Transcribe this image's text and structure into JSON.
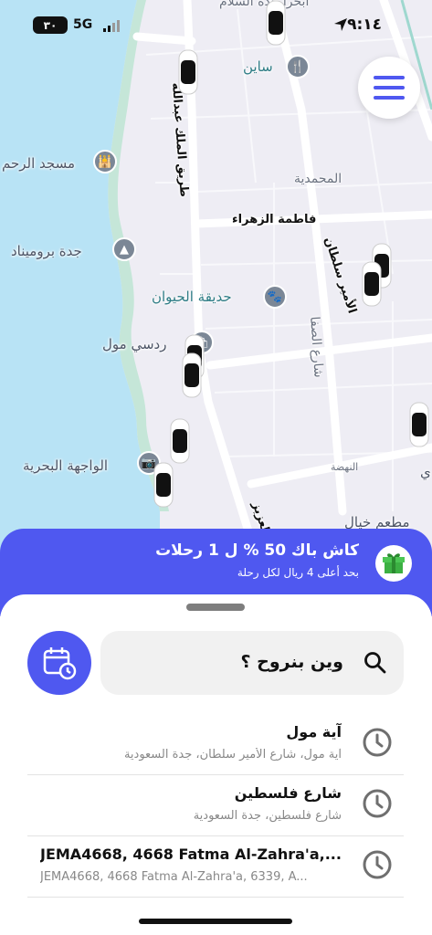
{
  "status_bar": {
    "time": "٩:١٤",
    "battery": "٣٠",
    "network": "5G"
  },
  "map": {
    "labels": {
      "sain": "ساين",
      "mosque": "مسجد الرحم",
      "mohammadia": "المحمدية",
      "fatma": "فاطمة الزهراء",
      "promenade": "جدة بروميناد",
      "zoo": "حديقة الحيوان",
      "mall": "ردسي مول",
      "safa": "شارع الصفا",
      "sultan": "الأمير سلطان",
      "waterfront": "الواجهة البحرية",
      "nahda": "النهضة",
      "restaurant": "مطعم خيال",
      "king_abdulaziz": "العزيز",
      "king_abdullah": "طريق الملك عبدالله",
      "top_road": "ابحرا جدة السلام",
      "right_edge": "ي"
    },
    "colors": {
      "sea": "#b8e3f5",
      "land": "#eeedf4",
      "road": "#ffffff",
      "green": "#c5e6d8"
    }
  },
  "menu": {
    "icon": "hamburger-icon"
  },
  "promo": {
    "title": "كاش باك 50 % ل 1 رحلات",
    "subtitle": "بحد أعلى 4 ريال لكل رحلة",
    "icon": "gift-icon",
    "color": "#4f58f0"
  },
  "search": {
    "placeholder": "وين بنروح ؟",
    "schedule_icon": "calendar-clock-icon"
  },
  "recent": [
    {
      "title": "آية مول",
      "subtitle": "آية مول، شارع الأمير سلطان، جدة السعودية"
    },
    {
      "title": "شارع فلسطين",
      "subtitle": "شارع فلسطين، جدة السعودية"
    },
    {
      "title": "JEMA4668, 4668 Fatma Al-Zahra'a,...",
      "subtitle": "JEMA4668, 4668 Fatma Al-Zahra'a, 6339, A..."
    }
  ]
}
